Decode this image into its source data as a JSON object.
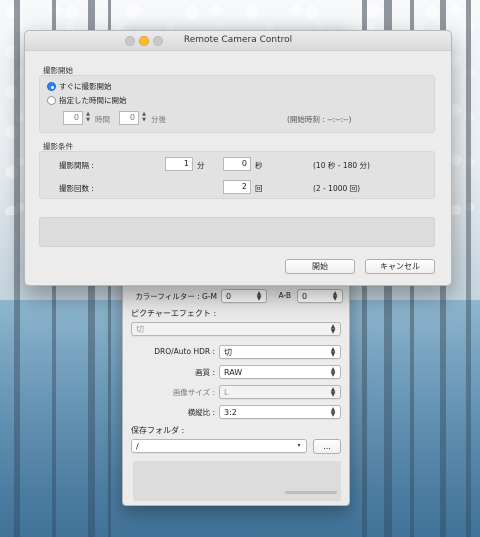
{
  "back_window": {
    "color_filter": {
      "label": "カラーフィルター : G-M",
      "gm_value": "0",
      "ab_label": "A-B",
      "ab_value": "0"
    },
    "picture_effect": {
      "label": "ピクチャーエフェクト :",
      "value": "切"
    },
    "dro": {
      "label": "DRO/Auto HDR :",
      "value": "切"
    },
    "quality": {
      "label": "画質 :",
      "value": "RAW"
    },
    "image_size": {
      "label": "画像サイズ :",
      "value": "L"
    },
    "aspect": {
      "label": "横縦比 :",
      "value": "3:2"
    },
    "save_folder": {
      "label": "保存フォルダ :",
      "value": "/",
      "browse_label": "..."
    }
  },
  "dialog": {
    "title": "Remote Camera Control",
    "start_group": {
      "title": "撮影開始",
      "radio_immediate": "すぐに撮影開始",
      "radio_scheduled": "指定した時間に開始",
      "hours_value": "0",
      "hours_unit": "時間",
      "minutes_value": "0",
      "minutes_unit": "分後",
      "start_time_text": "(開始時刻 : --:--:--)"
    },
    "conditions_group": {
      "title": "撮影条件",
      "interval_label": "撮影間隔 :",
      "interval_min_value": "1",
      "interval_min_unit": "分",
      "interval_sec_value": "0",
      "interval_sec_unit": "秒",
      "interval_range": "(10 秒 - 180 分)",
      "count_label": "撮影回数 :",
      "count_value": "2",
      "count_unit": "回",
      "count_range": "(2 - 1000 回)"
    },
    "start_button": "開始",
    "cancel_button": "キャンセル"
  },
  "colors": {
    "accent": "#2a7ff0",
    "close": "#fc5f57",
    "minimize": "#fdbc2e",
    "zoom": "#28c840"
  }
}
